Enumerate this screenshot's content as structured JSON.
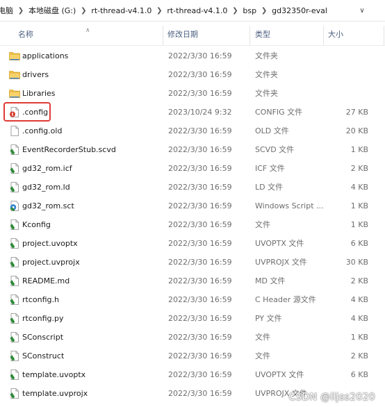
{
  "breadcrumb": [
    "电脑",
    "本地磁盘 (G:)",
    "rt-thread-v4.1.0",
    "rt-thread-v4.1.0",
    "bsp",
    "gd32350r-eval"
  ],
  "columns": {
    "name": "名称",
    "date": "修改日期",
    "type": "类型",
    "size": "大小"
  },
  "files": [
    {
      "name": "applications",
      "date": "2022/3/30 16:59",
      "type": "文件夹",
      "size": "",
      "icon": "folder-icon"
    },
    {
      "name": "drivers",
      "date": "2022/3/30 16:59",
      "type": "文件夹",
      "size": "",
      "icon": "folder-icon"
    },
    {
      "name": "Libraries",
      "date": "2022/3/30 16:59",
      "type": "文件夹",
      "size": "",
      "icon": "folder-icon"
    },
    {
      "name": ".config",
      "date": "2023/10/24 9:32",
      "type": "CONFIG 文件",
      "size": "27 KB",
      "icon": "config-file-icon"
    },
    {
      "name": ".config.old",
      "date": "2022/3/30 16:59",
      "type": "OLD 文件",
      "size": "20 KB",
      "icon": "blank-file-icon"
    },
    {
      "name": "EventRecorderStub.scvd",
      "date": "2022/3/30 16:59",
      "type": "SCVD 文件",
      "size": "1 KB",
      "icon": "script-file-icon"
    },
    {
      "name": "gd32_rom.icf",
      "date": "2022/3/30 16:59",
      "type": "ICF 文件",
      "size": "2 KB",
      "icon": "script-file-icon"
    },
    {
      "name": "gd32_rom.ld",
      "date": "2022/3/30 16:59",
      "type": "LD 文件",
      "size": "4 KB",
      "icon": "script-file-icon"
    },
    {
      "name": "gd32_rom.sct",
      "date": "2022/3/30 16:59",
      "type": "Windows Script ...",
      "size": "1 KB",
      "icon": "windows-script-icon"
    },
    {
      "name": "Kconfig",
      "date": "2022/3/30 16:59",
      "type": "文件",
      "size": "1 KB",
      "icon": "script-file-icon"
    },
    {
      "name": "project.uvoptx",
      "date": "2022/3/30 16:59",
      "type": "UVOPTX 文件",
      "size": "6 KB",
      "icon": "script-file-icon"
    },
    {
      "name": "project.uvprojx",
      "date": "2022/3/30 16:59",
      "type": "UVPROJX 文件",
      "size": "30 KB",
      "icon": "script-file-icon"
    },
    {
      "name": "README.md",
      "date": "2022/3/30 16:59",
      "type": "MD 文件",
      "size": "2 KB",
      "icon": "script-file-icon"
    },
    {
      "name": "rtconfig.h",
      "date": "2022/3/30 16:59",
      "type": "C Header 源文件",
      "size": "4 KB",
      "icon": "script-file-icon"
    },
    {
      "name": "rtconfig.py",
      "date": "2022/3/30 16:59",
      "type": "PY 文件",
      "size": "4 KB",
      "icon": "script-file-icon"
    },
    {
      "name": "SConscript",
      "date": "2022/3/30 16:59",
      "type": "文件",
      "size": "1 KB",
      "icon": "script-file-icon"
    },
    {
      "name": "SConstruct",
      "date": "2022/3/30 16:59",
      "type": "文件",
      "size": "2 KB",
      "icon": "script-file-icon"
    },
    {
      "name": "template.uvoptx",
      "date": "2022/3/30 16:59",
      "type": "UVOPTX 文件",
      "size": "6 KB",
      "icon": "script-file-icon"
    },
    {
      "name": "template.uvprojx",
      "date": "2022/3/30 16:59",
      "type": "UVPROJX 文件",
      "size": "",
      "icon": "script-file-icon"
    }
  ],
  "watermark": "CSDN @lljss2020",
  "colors": {
    "header_text": "#4d6082",
    "folder": "#f2c04b",
    "script_green": "#2e8b3a",
    "highlight": "#e03a36"
  }
}
